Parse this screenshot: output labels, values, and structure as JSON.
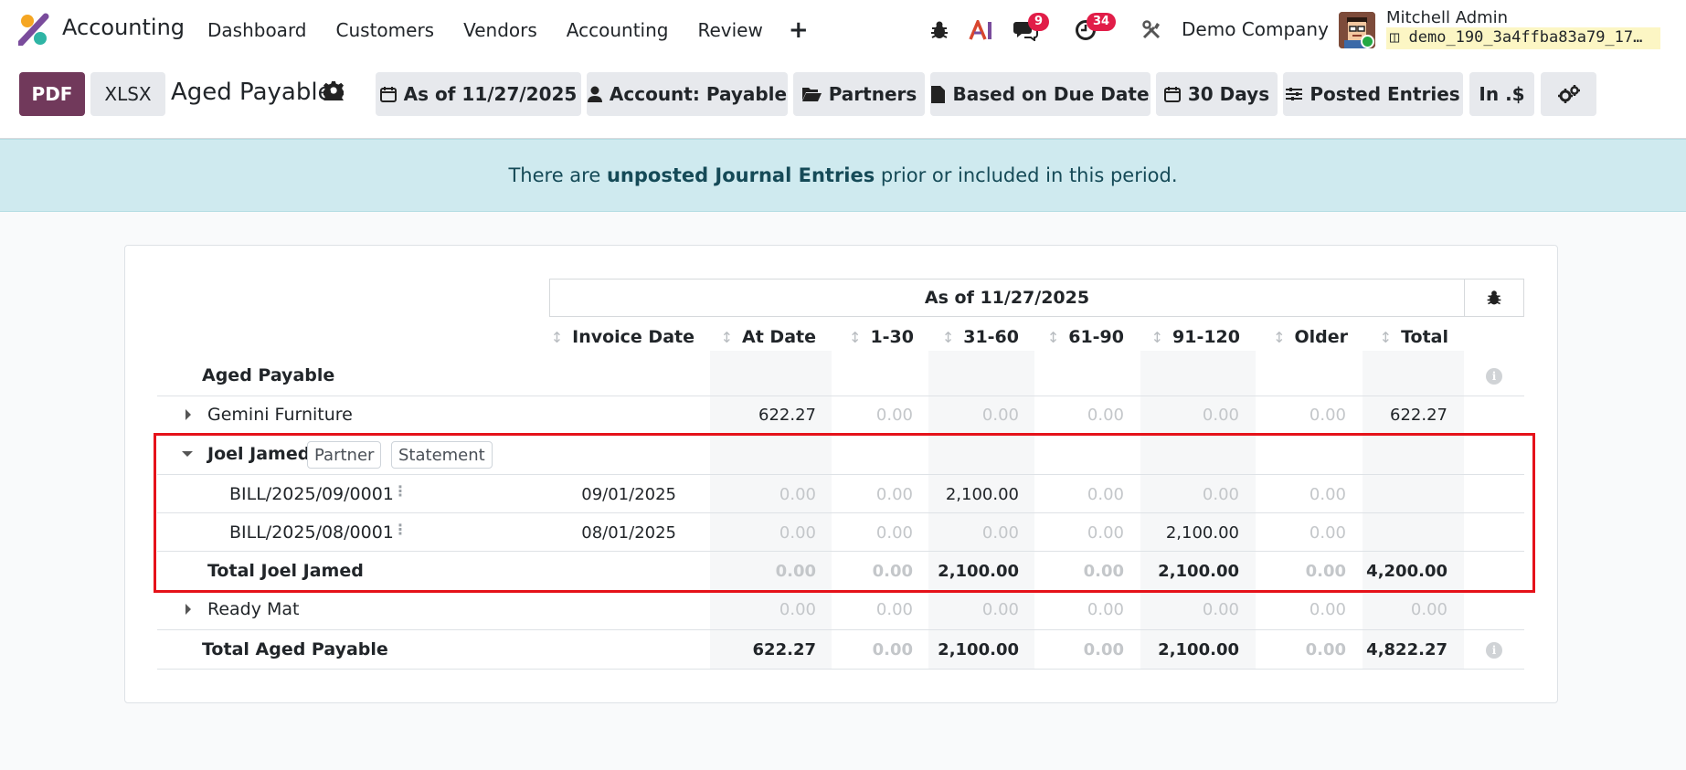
{
  "navbar": {
    "app_name": "Accounting",
    "menu": [
      "Dashboard",
      "Customers",
      "Vendors",
      "Accounting",
      "Review"
    ],
    "plus_label": "+",
    "messages_count": "9",
    "activities_count": "34",
    "company": "Demo Company",
    "user_name": "Mitchell Admin",
    "database": "demo_190_3a4ffba83a79_17…"
  },
  "control_panel": {
    "pdf_label": "PDF",
    "xlsx_label": "XLSX",
    "title": "Aged Payable",
    "filters": {
      "as_of": "As of 11/27/2025",
      "account": "Account: Payable",
      "partners": "Partners",
      "based_on": "Based on Due Date",
      "period": "30 Days",
      "entries": "Posted Entries",
      "currency": "In .$"
    }
  },
  "alert": {
    "before": "There are ",
    "link": "unposted Journal Entries",
    "after": " prior or included in this period."
  },
  "report": {
    "date_header": "As of 11/27/2025",
    "columns": [
      "Invoice Date",
      "At Date",
      "1-30",
      "31-60",
      "61-90",
      "91-120",
      "Older",
      "Total"
    ],
    "section_label": "Aged Payable",
    "rows": {
      "gemini": {
        "name": "Gemini Furniture",
        "values": [
          "622.27",
          "0.00",
          "0.00",
          "0.00",
          "0.00",
          "0.00",
          "622.27"
        ]
      },
      "joel": {
        "name": "Joel Jamed",
        "partner_chip": "Partner",
        "statement_chip": "Statement"
      },
      "bill1": {
        "name": "BILL/2025/09/0001",
        "date": "09/01/2025",
        "values": [
          "0.00",
          "0.00",
          "2,100.00",
          "0.00",
          "0.00",
          "0.00"
        ]
      },
      "bill2": {
        "name": "BILL/2025/08/0001",
        "date": "08/01/2025",
        "values": [
          "0.00",
          "0.00",
          "0.00",
          "0.00",
          "2,100.00",
          "0.00"
        ]
      },
      "total_joel": {
        "name": "Total Joel Jamed",
        "values": [
          "0.00",
          "0.00",
          "2,100.00",
          "0.00",
          "2,100.00",
          "0.00",
          "4,200.00"
        ]
      },
      "ready": {
        "name": "Ready Mat",
        "values": [
          "0.00",
          "0.00",
          "0.00",
          "0.00",
          "0.00",
          "0.00",
          "0.00"
        ]
      },
      "total": {
        "name": "Total Aged Payable",
        "values": [
          "622.27",
          "0.00",
          "2,100.00",
          "0.00",
          "2,100.00",
          "0.00",
          "4,822.27"
        ]
      }
    }
  }
}
